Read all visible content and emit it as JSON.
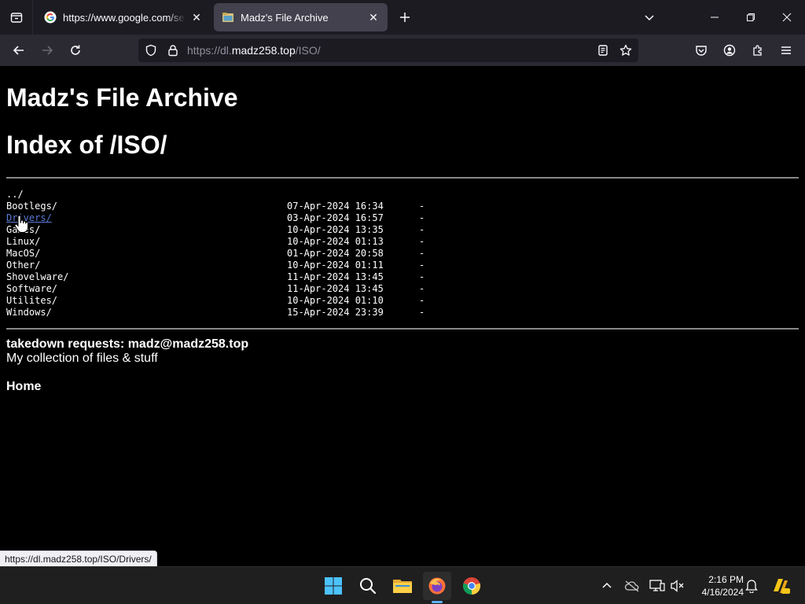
{
  "browser": {
    "tabs": [
      {
        "title": "https://www.google.com/search",
        "favicon": "google-icon",
        "active": false
      },
      {
        "title": "Madz's File Archive",
        "favicon": "folder-favicon",
        "active": true
      }
    ],
    "url_prefix": "https://dl.",
    "url_host": "madz258.top",
    "url_path": "/ISO/"
  },
  "page": {
    "site_title": "Madz's File Archive",
    "index_title": "Index of /ISO/",
    "parent_link": "../",
    "entries": [
      {
        "name": "Bootlegs/",
        "date": "07-Apr-2024 16:34",
        "size": "-"
      },
      {
        "name": "Drivers/",
        "date": "03-Apr-2024 16:57",
        "size": "-"
      },
      {
        "name": "Games/",
        "date": "10-Apr-2024 13:35",
        "size": "-"
      },
      {
        "name": "Linux/",
        "date": "10-Apr-2024 01:13",
        "size": "-"
      },
      {
        "name": "MacOS/",
        "date": "01-Apr-2024 20:58",
        "size": "-"
      },
      {
        "name": "Other/",
        "date": "10-Apr-2024 01:11",
        "size": "-"
      },
      {
        "name": "Shovelware/",
        "date": "11-Apr-2024 13:45",
        "size": "-"
      },
      {
        "name": "Software/",
        "date": "11-Apr-2024 13:45",
        "size": "-"
      },
      {
        "name": "Utilites/",
        "date": "10-Apr-2024 01:10",
        "size": "-"
      },
      {
        "name": "Windows/",
        "date": "15-Apr-2024 23:39",
        "size": "-"
      }
    ],
    "takedown": "takedown requests: madz@madz258.top",
    "description": "My collection of files & stuff",
    "home_link": "Home"
  },
  "status_url": "https://dl.madz258.top/ISO/Drivers/",
  "taskbar": {
    "time": "2:16 PM",
    "date": "4/16/2024"
  },
  "colors": {
    "hover_link": "#5b7bd6",
    "active_indicator": "#5fb2f2"
  }
}
